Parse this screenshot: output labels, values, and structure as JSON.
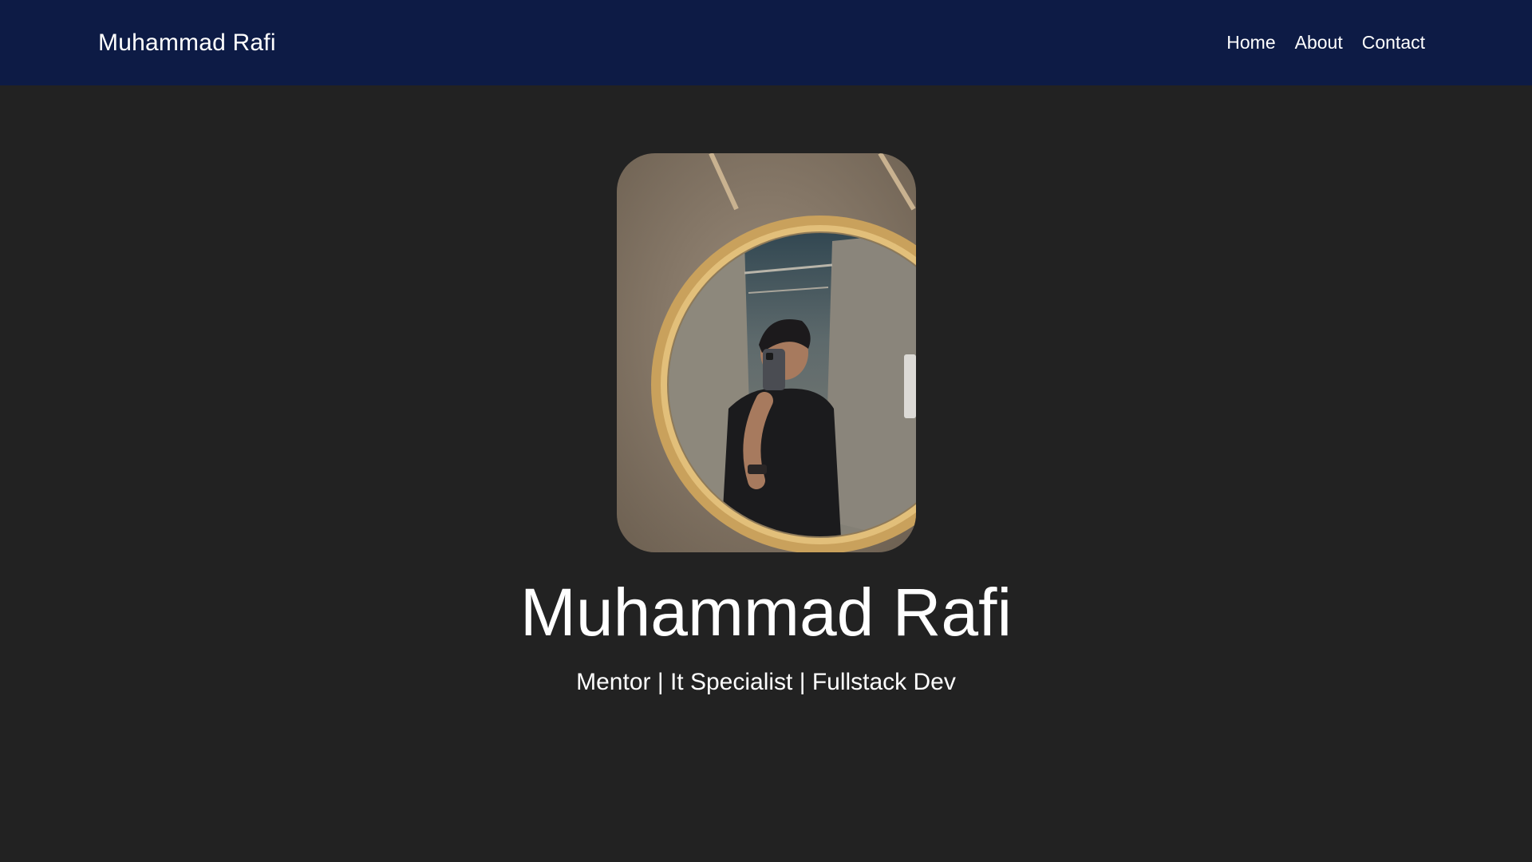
{
  "navbar": {
    "brand": "Muhammad Rafi",
    "links": [
      {
        "label": "Home"
      },
      {
        "label": "About"
      },
      {
        "label": "Contact"
      }
    ]
  },
  "hero": {
    "photo_description": "mirror-selfie-photo",
    "name": "Muhammad Rafi",
    "tagline": "Mentor | It Specialist | Fullstack Dev"
  },
  "colors": {
    "navbar_bg": "#0d1b45",
    "page_bg": "#222222",
    "text": "#ffffff"
  }
}
